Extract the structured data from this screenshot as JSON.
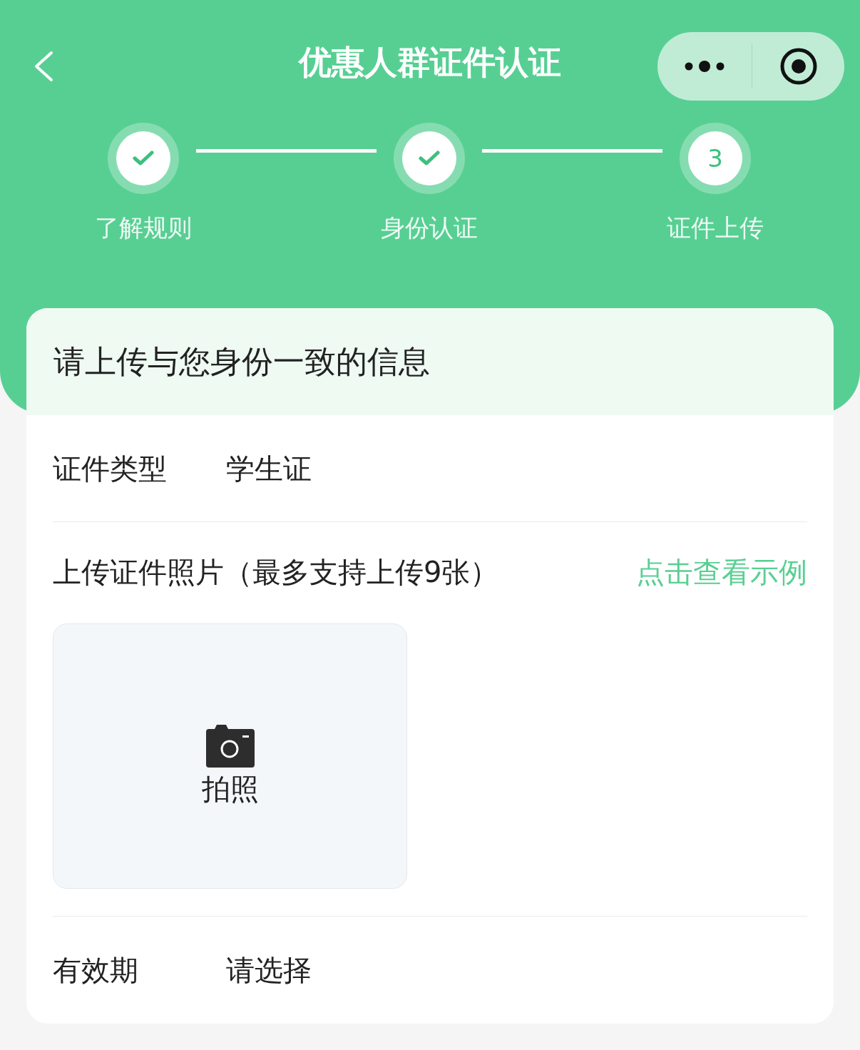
{
  "nav": {
    "title": "优惠人群证件认证"
  },
  "steps": [
    {
      "label": "了解规则",
      "kind": "done"
    },
    {
      "label": "身份认证",
      "kind": "done"
    },
    {
      "label": "证件上传",
      "number": "3",
      "kind": "current"
    }
  ],
  "card": {
    "heading": "请上传与您身份一致的信息",
    "rows": [
      {
        "kind": "field",
        "label": "证件类型",
        "value": "学生证"
      },
      {
        "kind": "upload",
        "label": "上传证件照片（最多支持上传9张）",
        "link": "点击查看示例",
        "button": "拍照"
      },
      {
        "kind": "field",
        "label": "有效期",
        "value": "请选择"
      }
    ]
  }
}
